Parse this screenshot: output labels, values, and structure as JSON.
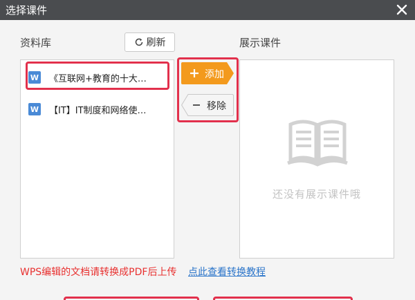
{
  "dialog": {
    "title": "选择课件"
  },
  "library": {
    "label": "资料库",
    "refresh_label": "刷新",
    "files": [
      {
        "type_icon": "W",
        "name": "《互联网+教育的十大…"
      },
      {
        "type_icon": "W",
        "name": "【IT】IT制度和网络使…"
      }
    ]
  },
  "actions": {
    "add_label": "添加",
    "remove_label": "移除"
  },
  "showcase": {
    "label": "展示课件",
    "empty_text": "还没有展示课件哦"
  },
  "notice": {
    "text": "WPS编辑的文档请转换成PDF后上传",
    "link": "点此查看转换教程"
  },
  "colors": {
    "titlebar": "#4a4c4f",
    "accent_orange": "#f39a1d",
    "highlight_red": "#e2304c",
    "notice_red": "#e8302f",
    "link_blue": "#2a74c9",
    "word_blue": "#4a8ad6"
  }
}
